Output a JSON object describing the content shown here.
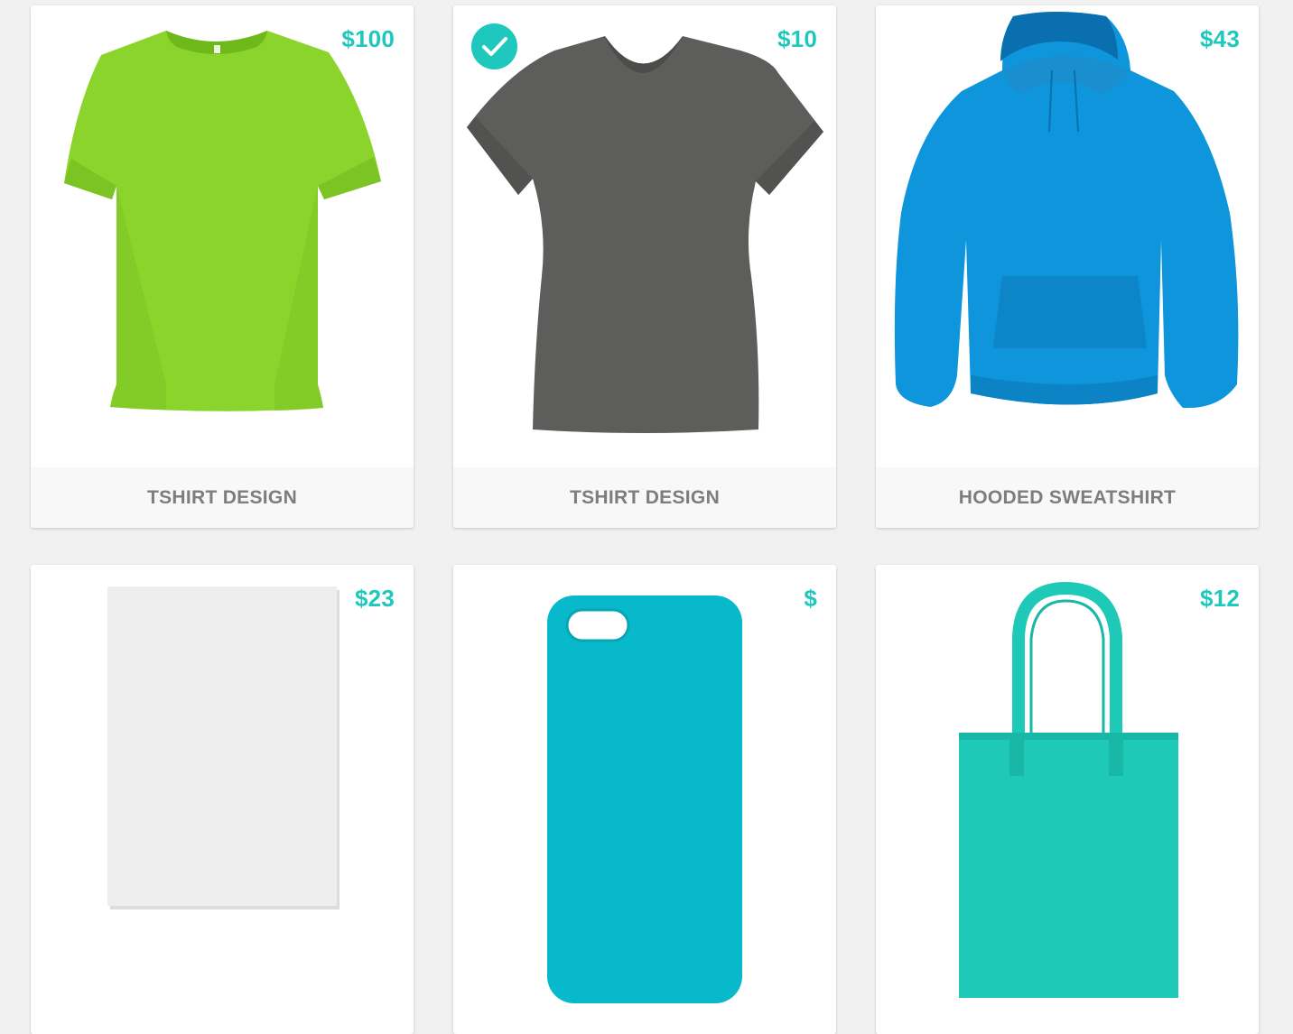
{
  "products": [
    {
      "name": "TSHIRT DESIGN",
      "price": "$100",
      "color": "#8bd42c",
      "icon": "tshirt-icon"
    },
    {
      "name": "TSHIRT DESIGN",
      "price": "$10",
      "color": "#5d5e5b",
      "icon": "fitted-tshirt-icon",
      "selected": true
    },
    {
      "name": "HOODED SWEATSHIRT",
      "price": "$43",
      "color": "#0e95db",
      "icon": "hoodie-icon"
    },
    {
      "name": "",
      "price": "$23",
      "color": "#eeeeee",
      "icon": "poster-icon"
    },
    {
      "name": "",
      "price": "$",
      "color": "#08b8cb",
      "icon": "phone-case-icon"
    },
    {
      "name": "",
      "price": "$12",
      "color": "#1ec9b7",
      "icon": "tote-bag-icon"
    }
  ],
  "accent_color": "#1ec8bd",
  "selected_icon": "checkmark-icon"
}
